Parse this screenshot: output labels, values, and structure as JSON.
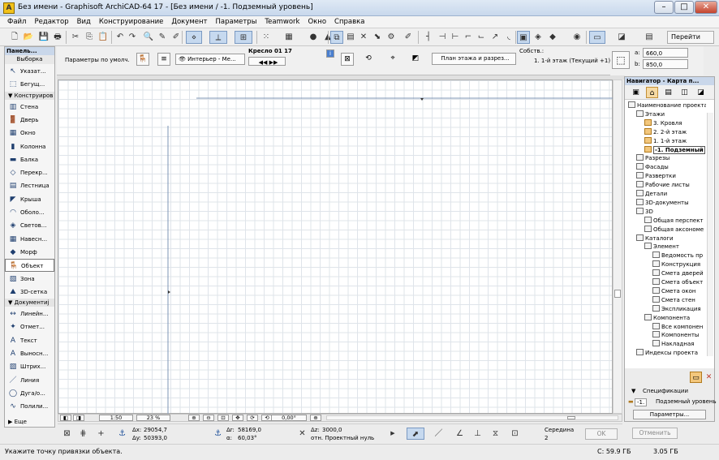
{
  "window": {
    "title": "Без имени - Graphisoft ArchiCAD-64 17 - [Без имени / -1. Подземный уровень]",
    "app_icon": "archicad-logo-icon"
  },
  "menu": [
    "Файл",
    "Редактор",
    "Вид",
    "Конструирование",
    "Документ",
    "Параметры",
    "Teamwork",
    "Окно",
    "Справка"
  ],
  "toolbar": {
    "goto_label": "Перейти"
  },
  "infobox": {
    "params_label": "Параметры по умолч.",
    "interior_label": "Интерьер - Ме...",
    "object_name": "Кресло 01 17",
    "plan_section_label": "План этажа и разрез...",
    "own_label": "Собств.:",
    "floor_label": "1. 1-й этаж (Текущий +1)",
    "dim_a": "660,0",
    "dim_b": "850,0",
    "dim_a_label": "a:",
    "dim_b_label": "b:"
  },
  "toolbox": {
    "title": "Панель...",
    "select_label": "Выборка",
    "items_top": [
      {
        "label": "Указат...",
        "icon": "arrow-pointer-icon"
      },
      {
        "label": "Бегущ...",
        "icon": "marquee-icon"
      }
    ],
    "group_construct": "Конструиров",
    "construct": [
      {
        "label": "Стена",
        "icon": "wall-icon"
      },
      {
        "label": "Дверь",
        "icon": "door-icon"
      },
      {
        "label": "Окно",
        "icon": "window-icon"
      },
      {
        "label": "Колонна",
        "icon": "column-icon"
      },
      {
        "label": "Балка",
        "icon": "beam-icon"
      },
      {
        "label": "Перекр...",
        "icon": "slab-icon"
      },
      {
        "label": "Лестница",
        "icon": "stair-icon"
      },
      {
        "label": "Крыша",
        "icon": "roof-icon"
      },
      {
        "label": "Оболо...",
        "icon": "shell-icon"
      },
      {
        "label": "Светов...",
        "icon": "skylight-icon"
      },
      {
        "label": "Навесн...",
        "icon": "curtain-wall-icon"
      },
      {
        "label": "Морф",
        "icon": "morph-icon"
      },
      {
        "label": "Объект",
        "icon": "object-icon"
      },
      {
        "label": "Зона",
        "icon": "zone-icon"
      },
      {
        "label": "3D-сетка",
        "icon": "mesh-icon"
      }
    ],
    "group_document": "Документиј",
    "document": [
      {
        "label": "Линейн...",
        "icon": "dimension-icon"
      },
      {
        "label": "Отмет...",
        "icon": "level-dimension-icon"
      },
      {
        "label": "Текст",
        "icon": "text-icon"
      },
      {
        "label": "Выносн...",
        "icon": "label-icon"
      },
      {
        "label": "Штрих...",
        "icon": "fill-icon"
      },
      {
        "label": "Линия",
        "icon": "line-icon"
      },
      {
        "label": "Дуга/о...",
        "icon": "arc-icon"
      },
      {
        "label": "Полили...",
        "icon": "polyline-icon"
      }
    ],
    "more_label": "Еще"
  },
  "bottom": {
    "scale": "1:50",
    "zoom": "23 %",
    "angle": "0,00°",
    "dx_label": "Δx:",
    "dx": "29054,7",
    "dy_label": "Δy:",
    "dy": "50393,0",
    "dr_label": "Δr:",
    "dr": "58169,0",
    "alpha_label": "α:",
    "alpha": "60,03°",
    "dz_label": "Δz:",
    "dz": "3000,0",
    "ref_label": "отн. Проектный нуль",
    "snap_label": "Середина",
    "snap_value": "2",
    "ok_label": "OK",
    "cancel_label": "Отменить"
  },
  "navigator": {
    "title": "Навигатор - Карта п...",
    "tree": [
      {
        "label": "Наименование проекта",
        "level": 0,
        "folder": false
      },
      {
        "label": "Этажи",
        "level": 1,
        "folder": false
      },
      {
        "label": "3. Кровля",
        "level": 2,
        "folder": true
      },
      {
        "label": "2. 2-й этаж",
        "level": 2,
        "folder": true
      },
      {
        "label": "1. 1-й этаж",
        "level": 2,
        "folder": true
      },
      {
        "label": "-1. Подземный",
        "level": 2,
        "folder": true,
        "current": true
      },
      {
        "label": "Разрезы",
        "level": 1,
        "folder": false
      },
      {
        "label": "Фасады",
        "level": 1,
        "folder": false
      },
      {
        "label": "Развертки",
        "level": 1,
        "folder": false
      },
      {
        "label": "Рабочие листы",
        "level": 1,
        "folder": false
      },
      {
        "label": "Детали",
        "level": 1,
        "folder": false
      },
      {
        "label": "3D-документы",
        "level": 1,
        "folder": false
      },
      {
        "label": "3D",
        "level": 1,
        "folder": false
      },
      {
        "label": "Общая перспект",
        "level": 2,
        "folder": false
      },
      {
        "label": "Общая аксономе",
        "level": 2,
        "folder": false
      },
      {
        "label": "Каталоги",
        "level": 1,
        "folder": false
      },
      {
        "label": "Элемент",
        "level": 2,
        "folder": false
      },
      {
        "label": "Ведомость пр",
        "level": 3,
        "folder": false
      },
      {
        "label": "Конструкция",
        "level": 3,
        "folder": false
      },
      {
        "label": "Смета дверей",
        "level": 3,
        "folder": false
      },
      {
        "label": "Смета объект",
        "level": 3,
        "folder": false
      },
      {
        "label": "Смета окон",
        "level": 3,
        "folder": false
      },
      {
        "label": "Смета стен",
        "level": 3,
        "folder": false
      },
      {
        "label": "Экспликация",
        "level": 3,
        "folder": false
      },
      {
        "label": "Компонента",
        "level": 2,
        "folder": false
      },
      {
        "label": "Все компонен",
        "level": 3,
        "folder": false
      },
      {
        "label": "Компоненты",
        "level": 3,
        "folder": false
      },
      {
        "label": "Накладная",
        "level": 3,
        "folder": false
      },
      {
        "label": "Индексы проекта",
        "level": 1,
        "folder": false
      }
    ],
    "spec_label": "Спецификации",
    "floor_num": "-1.",
    "floor_name": "Подземный уровень",
    "params_label": "Параметры..."
  },
  "status": {
    "message": "Укажите точку привязки объекта.",
    "disk_c": "C: 59.9 ГБ",
    "mem": "3.05 ГБ"
  }
}
